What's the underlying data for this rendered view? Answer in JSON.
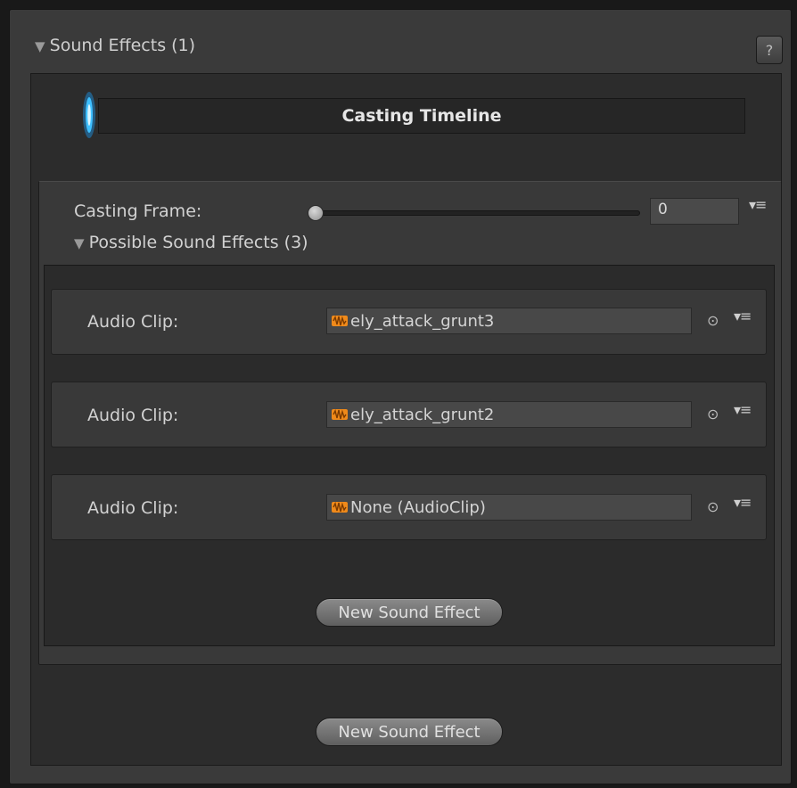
{
  "section": {
    "title": "Sound Effects (1)",
    "help_label": "?"
  },
  "timeline": {
    "title": "Casting Timeline"
  },
  "frame": {
    "label": "Casting Frame:",
    "value": "0",
    "slider_level": 0
  },
  "possible": {
    "title": "Possible Sound Effects (3)",
    "clips": [
      {
        "label": "Audio Clip:",
        "value": "ely_attack_grunt3"
      },
      {
        "label": "Audio Clip:",
        "value": "ely_attack_grunt2"
      },
      {
        "label": "Audio Clip:",
        "value": "None (AudioClip)"
      }
    ],
    "new_button": "New Sound Effect"
  },
  "outer_new_button": "New Sound Effect",
  "icons": {
    "foldout": "triangle-down-icon",
    "audio": "audio-clip-icon",
    "picker": "object-picker-icon",
    "menu": "context-menu-icon",
    "timeline": "blue-flame-icon"
  },
  "colors": {
    "accent_orange": "#f08a1a",
    "timeline_blue": "#27a3e6"
  }
}
